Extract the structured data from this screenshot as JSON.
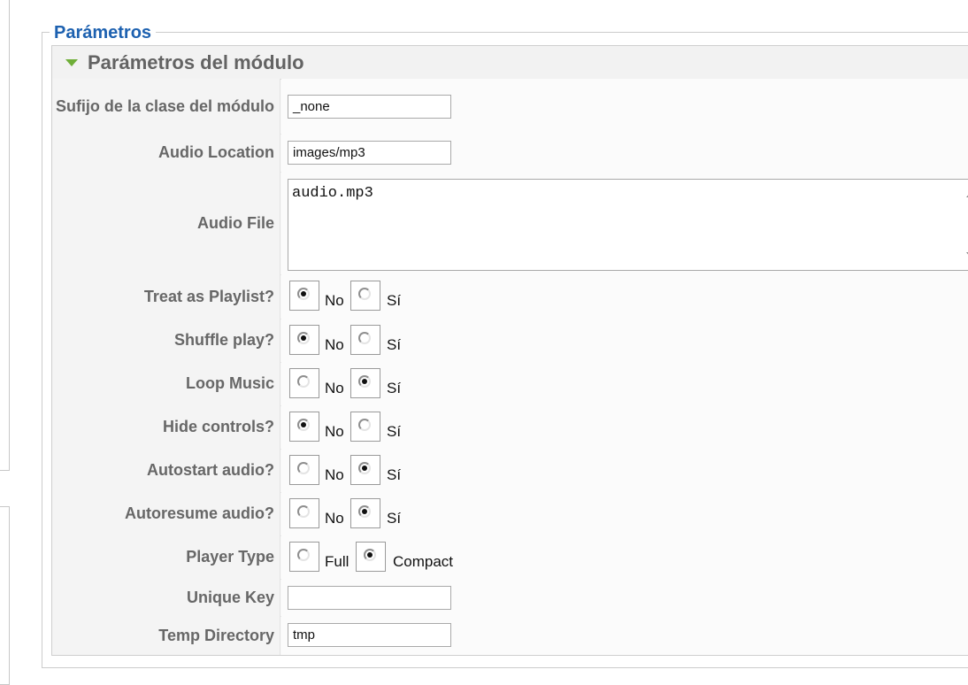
{
  "fieldset": {
    "legend": "Parámetros"
  },
  "panel": {
    "title": "Parámetros del módulo"
  },
  "fields": {
    "suffix": {
      "label": "Sufijo de la clase del módulo",
      "value": "_none"
    },
    "audio_location": {
      "label": "Audio Location",
      "value": "images/mp3"
    },
    "audio_file": {
      "label": "Audio File",
      "value": "audio.mp3"
    },
    "unique_key": {
      "label": "Unique Key",
      "value": ""
    },
    "temp_directory": {
      "label": "Temp Directory",
      "value": "tmp"
    }
  },
  "radios": {
    "treat_as_playlist": {
      "label": "Treat as Playlist?",
      "options": [
        "No",
        "Sí"
      ],
      "selected": "No"
    },
    "shuffle_play": {
      "label": "Shuffle play?",
      "options": [
        "No",
        "Sí"
      ],
      "selected": "No"
    },
    "loop_music": {
      "label": "Loop Music",
      "options": [
        "No",
        "Sí"
      ],
      "selected": "Sí"
    },
    "hide_controls": {
      "label": "Hide controls?",
      "options": [
        "No",
        "Sí"
      ],
      "selected": "No"
    },
    "autostart_audio": {
      "label": "Autostart audio?",
      "options": [
        "No",
        "Sí"
      ],
      "selected": "Sí"
    },
    "autoresume_audio": {
      "label": "Autoresume audio?",
      "options": [
        "No",
        "Sí"
      ],
      "selected": "Sí"
    },
    "player_type": {
      "label": "Player Type",
      "options": [
        "Full",
        "Compact"
      ],
      "selected": "Compact"
    }
  }
}
